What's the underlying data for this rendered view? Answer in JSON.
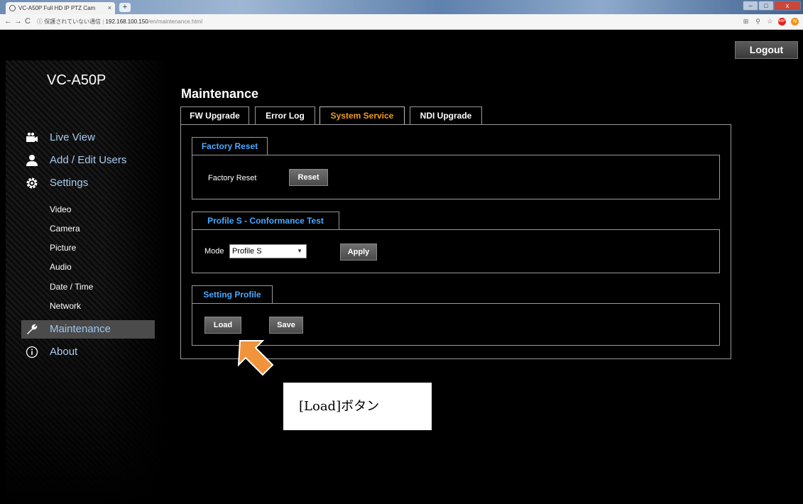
{
  "browser": {
    "tab_title": "VC-A50P Full HD IP PTZ Cam",
    "tab_close": "×",
    "new_tab": "+",
    "back": "←",
    "forward": "→",
    "reload": "C",
    "security_icon": "ⓘ",
    "security_text": "保護されていない通信",
    "url_host": "192.168.100.150",
    "url_path": "/en/maintenance.html",
    "win_min": "–",
    "win_max": "□",
    "win_close": "x",
    "ext_red": "ABP",
    "ext_orange": "N"
  },
  "header": {
    "logout_label": "Logout"
  },
  "brand": "VC-A50P",
  "sidebar": {
    "items": [
      {
        "label": "Live View",
        "icon": "video-camera-icon"
      },
      {
        "label": "Add / Edit Users",
        "icon": "user-icon"
      },
      {
        "label": "Settings",
        "icon": "gear-icon"
      }
    ],
    "sub_items": [
      "Video",
      "Camera",
      "Picture",
      "Audio",
      "Date / Time",
      "Network"
    ],
    "maintenance": {
      "label": "Maintenance",
      "icon": "wrench-icon"
    },
    "about": {
      "label": "About",
      "icon": "info-circle-icon"
    }
  },
  "main": {
    "title": "Maintenance",
    "tabs": [
      {
        "label": "FW Upgrade"
      },
      {
        "label": "Error Log"
      },
      {
        "label": "System Service",
        "active": true
      },
      {
        "label": "NDI Upgrade"
      }
    ],
    "factory_reset": {
      "section_label": "Factory Reset",
      "row_label": "Factory Reset",
      "reset_label": "Reset"
    },
    "profile_s": {
      "section_label": "Profile S - Conformance Test",
      "mode_label": "Mode",
      "mode_value": "Profile S",
      "caret": "▼",
      "apply_label": "Apply"
    },
    "setting_profile": {
      "section_label": "Setting Profile",
      "load_label": "Load",
      "save_label": "Save"
    }
  },
  "callout": {
    "text": "[Load]ボタン"
  },
  "colors": {
    "accent_orange": "#f39a1e",
    "link_blue": "#4aa8ff",
    "nav_blue": "#a9cdf2"
  }
}
